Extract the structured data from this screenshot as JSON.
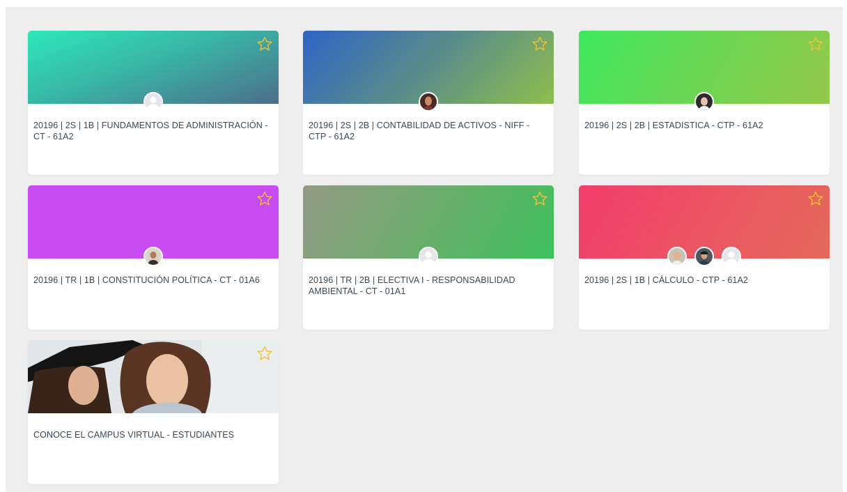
{
  "courses": [
    {
      "title": "20196 | 2S | 1B | FUNDAMENTOS DE ADMINISTRACIÓN - CT - 61A2",
      "banner_colors": [
        "#2de8b9",
        "#4e6e8a"
      ],
      "avatars": [
        "default-user-avatar"
      ]
    },
    {
      "title": "20196 | 2S | 2B | CONTABILIDAD DE ACTIVOS - NIFF - CTP - 61A2",
      "banner_colors": [
        "#2f64c6",
        "#8fbe4e"
      ],
      "avatars": [
        "teacher-photo-avatar"
      ]
    },
    {
      "title": "20196 | 2S | 2B | ESTADISTICA - CTP - 61A2",
      "banner_colors": [
        "#3ee85e",
        "#95c84a"
      ],
      "avatars": [
        "teacher-photo-avatar"
      ]
    },
    {
      "title": "20196 | TR | 1B | CONSTITUCIÓN POLÍTICA - CT - 01A6",
      "banner_colors": [
        "#c84cf2",
        "#c84cf2"
      ],
      "avatars": [
        "teacher-photo-avatar"
      ]
    },
    {
      "title": "20196 | TR | 2B | ELECTIVA I - RESPONSABILIDAD AMBIENTAL - CT - 01A1",
      "banner_colors": [
        "#939a84",
        "#3dc05c"
      ],
      "avatars": [
        "default-user-avatar"
      ]
    },
    {
      "title": "20196 | 2S | 1B | CÁLCULO - CTP - 61A2",
      "banner_colors": [
        "#f23d6d",
        "#e36a5a"
      ],
      "avatars": [
        "teacher-photo-avatar",
        "teacher-photo-avatar",
        "default-user-avatar"
      ]
    },
    {
      "title": "CONOCE EL CAMPUS VIRTUAL - ESTUDIANTES",
      "banner_image": "two-students-photo",
      "avatars": []
    }
  ],
  "colors": {
    "page_background": "#eeeeee",
    "star_outline": "#f1c232",
    "title_text": "#34495e"
  },
  "icons": {
    "favorite": "star-outline-icon"
  }
}
